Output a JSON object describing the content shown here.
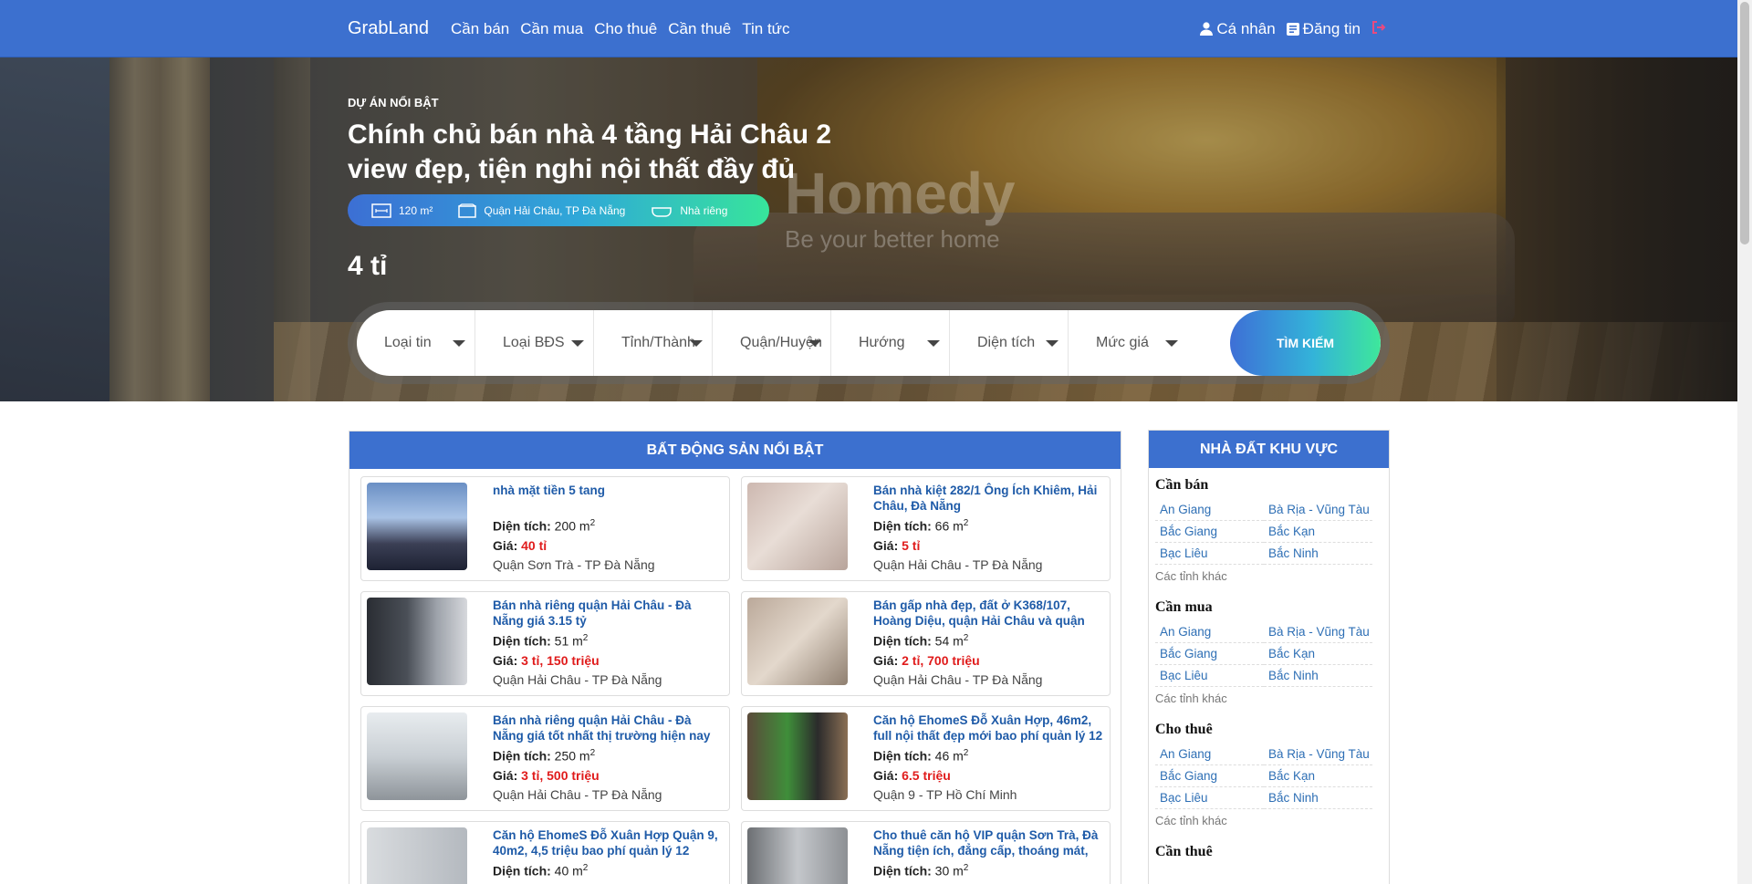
{
  "nav": {
    "brand": "GrabLand",
    "links": [
      "Cần bán",
      "Cần mua",
      "Cho thuê",
      "Cần thuê",
      "Tin tức"
    ],
    "profile": "Cá nhân",
    "post": "Đăng tin"
  },
  "hero": {
    "label": "DỰ ÁN NỔI BẬT",
    "title": "Chính chủ bán nhà 4 tầng Hải Châu 2 view đẹp, tiện nghi nội thất đầy đủ",
    "area": "120 m²",
    "location": "Quận Hải Châu, TP Đà Nẵng",
    "type": "Nhà riêng",
    "price": "4 tỉ",
    "watermark": "Homedy",
    "watermark_sub": "Be your better home"
  },
  "search": {
    "fields": [
      "Loại tin",
      "Loại BĐS",
      "Tỉnh/Thành",
      "Quận/Huyện",
      "Hướng",
      "Diện tích",
      "Mức giá"
    ],
    "button": "TÌM KIẾM"
  },
  "listings": {
    "heading": "BẤT ĐỘNG SẢN NỔI BẬT",
    "area_label": "Diện tích:",
    "price_label": "Giá:",
    "items": [
      {
        "title": "nhà mặt tiền 5 tang",
        "area": "200 m",
        "price": "40 tỉ",
        "location": "Quận Sơn Trà - TP Đà Nẵng"
      },
      {
        "title": "Bán nhà kiệt 282/1 Ông Ích Khiêm, Hải Châu, Đà Nẵng",
        "area": "66 m",
        "price": "5 tỉ",
        "location": "Quận Hải Châu - TP Đà Nẵng"
      },
      {
        "title": "Bán nhà riêng quận Hải Châu - Đà Nẵng giá 3.15 tỷ",
        "area": "51 m",
        "price": "3 tỉ, 150 triệu",
        "location": "Quận Hải Châu - TP Đà Nẵng"
      },
      {
        "title": "Bán gấp nhà đẹp, đất ở K368/107, Hoàng Diệu, quận Hải Châu và quận",
        "area": "54 m",
        "price": "2 tỉ, 700 triệu",
        "location": "Quận Hải Châu - TP Đà Nẵng"
      },
      {
        "title": "Bán nhà riêng quận Hải Châu - Đà Nẵng giá tốt nhất thị trường hiện nay",
        "area": "250 m",
        "price": "3 tỉ, 500 triệu",
        "location": "Quận Hải Châu - TP Đà Nẵng"
      },
      {
        "title": "Căn hộ EhomeS Đỗ Xuân Hợp, 46m2, full nội thất đẹp mới bao phí quản lý 12",
        "area": "46 m",
        "price": "6.5 triệu",
        "location": "Quận 9 - TP Hồ Chí Minh"
      },
      {
        "title": "Căn hộ EhomeS Đỗ Xuân Hợp Quận 9, 40m2, 4,5 triệu bao phí quản lý 12",
        "area": "40 m",
        "price": "",
        "location": ""
      },
      {
        "title": "Cho thuê căn hộ VIP quận Sơn Trà, Đà Nẵng tiện ích, đẳng cấp, thoáng mát,",
        "area": "30 m",
        "price": "",
        "location": ""
      }
    ]
  },
  "sidebar": {
    "heading": "NHÀ ĐẤT KHU VỰC",
    "groups": [
      {
        "title": "Cần bán",
        "provinces": [
          "An Giang",
          "Bà Rịa - Vũng Tàu",
          "Bắc Giang",
          "Bắc Kạn",
          "Bạc Liêu",
          "Bắc Ninh"
        ],
        "other": "Các tỉnh khác"
      },
      {
        "title": "Cần mua",
        "provinces": [
          "An Giang",
          "Bà Rịa - Vũng Tàu",
          "Bắc Giang",
          "Bắc Kạn",
          "Bạc Liêu",
          "Bắc Ninh"
        ],
        "other": "Các tỉnh khác"
      },
      {
        "title": "Cho thuê",
        "provinces": [
          "An Giang",
          "Bà Rịa - Vũng Tàu",
          "Bắc Giang",
          "Bắc Kạn",
          "Bạc Liêu",
          "Bắc Ninh"
        ],
        "other": "Các tỉnh khác"
      },
      {
        "title": "Cần thuê",
        "provinces": [],
        "other": ""
      }
    ]
  },
  "colors": {
    "primary": "#3c70cf",
    "price": "#e01b1b",
    "link": "#1f5ba8"
  }
}
